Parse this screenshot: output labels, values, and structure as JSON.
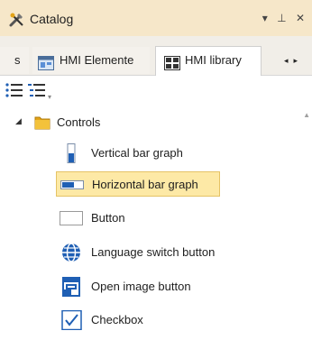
{
  "panel": {
    "title": "Catalog",
    "controls": {
      "dropdown": "▾",
      "pin": "⊥",
      "close": "✕"
    }
  },
  "tabs": [
    {
      "label": "s",
      "icon": "truncated-tab"
    },
    {
      "label": "HMI Elemente",
      "icon": "hmi-elements-icon"
    },
    {
      "label": "HMI library",
      "icon": "hmi-library-icon",
      "active": true
    }
  ],
  "tab_nav": {
    "prev": "◂",
    "next": "▸"
  },
  "toolbar": {
    "items": [
      {
        "icon": "tree-view-icon"
      },
      {
        "icon": "list-view-icon"
      }
    ]
  },
  "tree": {
    "root": {
      "label": "Controls",
      "expanded": true
    },
    "items": [
      {
        "label": "Vertical bar graph",
        "icon": "vertical-bar-graph-icon"
      },
      {
        "label": "Horizontal bar graph",
        "icon": "horizontal-bar-graph-icon",
        "selected": true
      },
      {
        "label": "Button",
        "icon": "button-icon"
      },
      {
        "label": "Language switch button",
        "icon": "globe-icon"
      },
      {
        "label": "Open image button",
        "icon": "open-image-icon"
      },
      {
        "label": "Checkbox",
        "icon": "checkbox-icon"
      }
    ]
  },
  "colors": {
    "title_bar": "#f6e7c9",
    "selection": "#fde9a6",
    "selection_border": "#e5c365",
    "accent_blue": "#1f5fb4"
  }
}
